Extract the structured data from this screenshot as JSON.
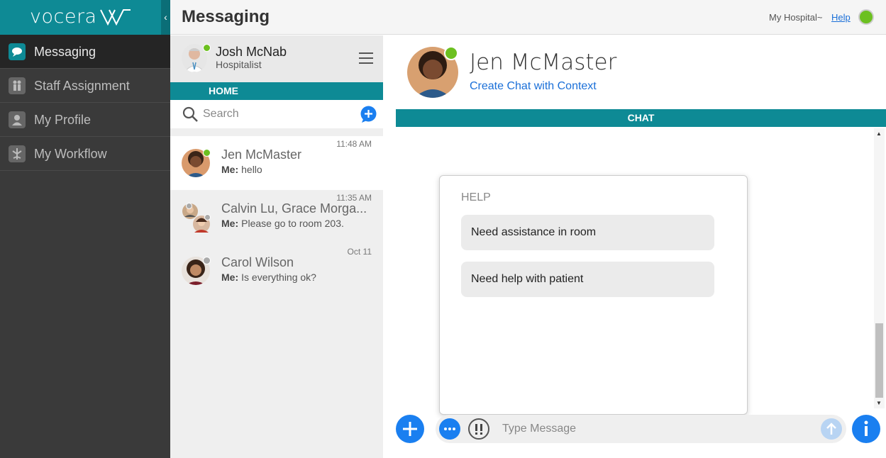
{
  "brand": {
    "logo_text": "vocera",
    "collapse_icon": "‹"
  },
  "nav": {
    "items": [
      {
        "label": "Messaging",
        "icon": "chat-bubble-icon",
        "active": true
      },
      {
        "label": "Staff Assignment",
        "icon": "people-icon",
        "active": false
      },
      {
        "label": "My Profile",
        "icon": "person-icon",
        "active": false
      },
      {
        "label": "My Workflow",
        "icon": "workflow-icon",
        "active": false
      }
    ]
  },
  "header": {
    "title": "Messaging",
    "hospital": "My Hospital~",
    "help": "Help",
    "status_color": "#6cc020"
  },
  "user": {
    "name": "Josh McNab",
    "role": "Hospitalist",
    "status": "online"
  },
  "home_tab": "HOME",
  "search": {
    "placeholder": "Search"
  },
  "conversations": [
    {
      "name": "Jen McMaster",
      "time": "11:48 AM",
      "sender": "Me:",
      "message": "hello",
      "status": "online",
      "selected": true
    },
    {
      "name": "Calvin Lu, Grace Morga...",
      "time": "11:35 AM",
      "sender": "Me:",
      "message": "Please go to room 203.",
      "status": "group",
      "selected": false
    },
    {
      "name": "Carol Wilson",
      "time": "Oct 11",
      "sender": "Me:",
      "message": "Is everything ok?",
      "status": "offline",
      "selected": false
    }
  ],
  "chat": {
    "contact_name": "Jen McMaster",
    "context_link": "Create Chat with Context",
    "tab": "CHAT",
    "status": "online"
  },
  "help_popup": {
    "title": "HELP",
    "options": [
      "Need assistance in room",
      "Need help with patient"
    ]
  },
  "composer": {
    "placeholder": "Type Message",
    "add_icon": "plus-icon",
    "more_icon": "ellipsis-icon",
    "urgent_icon": "urgent-icon",
    "send_icon": "send-arrow-icon",
    "info_icon": "info-icon"
  },
  "colors": {
    "accent": "#0e8a95",
    "primary_blue": "#1a7ff0",
    "online": "#6cc020",
    "sidebar": "#3a3a3a"
  }
}
